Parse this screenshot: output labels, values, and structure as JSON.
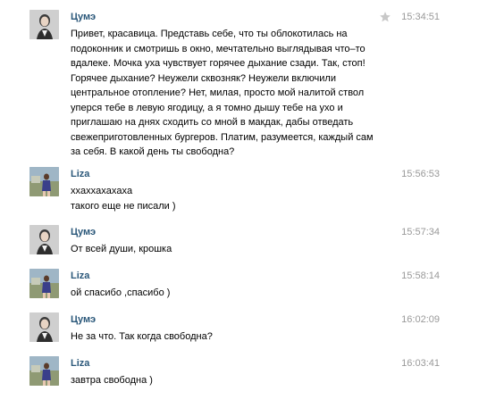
{
  "messages": [
    {
      "author": "Цумэ",
      "time": "15:34:51",
      "text": "Привет, красавица. Представь себе, что ты облокотилась на\nподоконник и смотришь в окно, мечтательно выглядывая что–то\nвдалеке. Мочка уха чувствует горячее дыхание сзади. Так, стоп!\nГорячее дыхание? Неужели сквозняк? Неужели включили\nцентральное отопление? Нет, милая, просто мой налитой ствол\nуперся тебе в левую ягодицу, а я томно дышу тебе на ухо и\nприглашаю на днях сходить со мной в макдак, дабы отведать\nсвежеприготовленных бургеров. Платим, разумеется, каждый сам\nза себя. В какой день ты свободна?",
      "avatar_icon": "user-avatar-photo",
      "has_star": true
    },
    {
      "author": "Liza",
      "time": "15:56:53",
      "text": "xxaxxaxaxaxa\nтакого еще не писали )",
      "avatar_icon": "user-avatar-photo"
    },
    {
      "author": "Цумэ",
      "time": "15:57:34",
      "text": "От всей души, крошка",
      "avatar_icon": "user-avatar-photo"
    },
    {
      "author": "Liza",
      "time": "15:58:14",
      "text": "ой спасибо ,спасибо )",
      "avatar_icon": "user-avatar-photo"
    },
    {
      "author": "Цумэ",
      "time": "16:02:09",
      "text": "Не за что. Так когда свободна?",
      "avatar_icon": "user-avatar-photo"
    },
    {
      "author": "Liza",
      "time": "16:03:41",
      "text": "завтра свободна )",
      "avatar_icon": "user-avatar-photo"
    }
  ],
  "colors": {
    "author_link": "#2b587a",
    "timestamp": "#999999",
    "star": "#c8c8c8"
  }
}
